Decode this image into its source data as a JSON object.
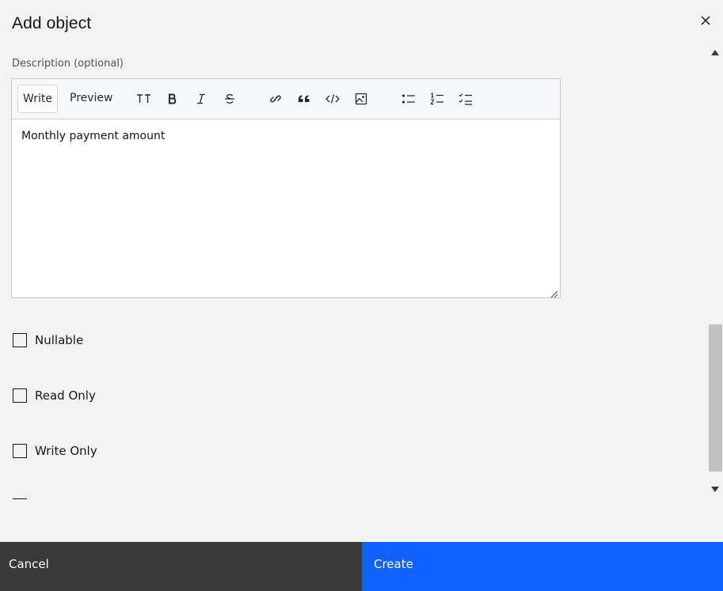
{
  "modal": {
    "title": "Add object",
    "close_icon": "close-icon"
  },
  "description": {
    "label": "Description (optional)",
    "value": "Monthly payment amount"
  },
  "editor_toolbar": {
    "tab_write": "Write",
    "tab_preview": "Preview",
    "buttons": [
      {
        "icon": "text-size-icon",
        "glyph": "TT"
      },
      {
        "icon": "bold-icon",
        "glyph": "B"
      },
      {
        "icon": "italic-icon",
        "glyph": "I"
      },
      {
        "icon": "strikethrough-icon",
        "glyph": "S"
      },
      {
        "icon": "link-icon"
      },
      {
        "icon": "quote-icon"
      },
      {
        "icon": "code-icon"
      },
      {
        "icon": "image-icon"
      },
      {
        "icon": "bulleted-list-icon"
      },
      {
        "icon": "numbered-list-icon"
      },
      {
        "icon": "task-list-icon"
      }
    ]
  },
  "checkboxes": [
    {
      "label": "Nullable",
      "checked": false
    },
    {
      "label": "Read Only",
      "checked": false
    },
    {
      "label": "Write Only",
      "checked": false
    }
  ],
  "footer": {
    "cancel_label": "Cancel",
    "create_label": "Create"
  },
  "colors": {
    "primary": "#0f62fe",
    "secondary": "#393939",
    "background": "#f3f3f3"
  }
}
